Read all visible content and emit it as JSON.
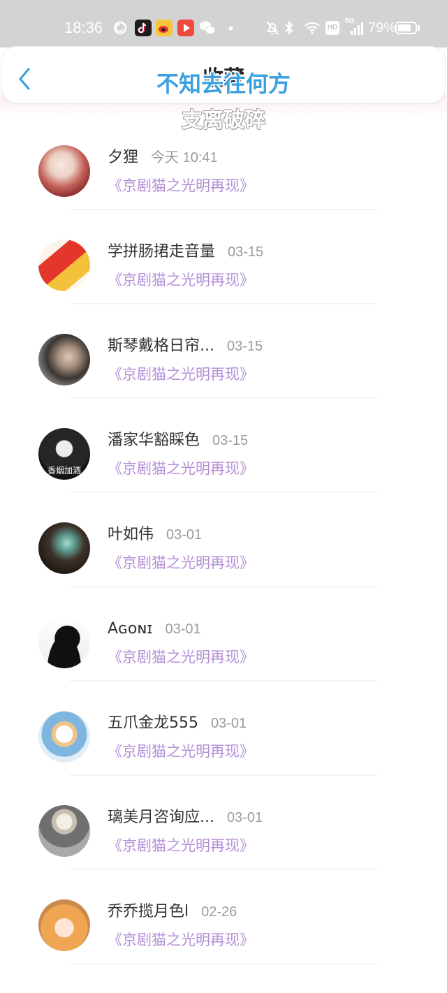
{
  "status_bar": {
    "time": "18:36",
    "notification_icons": [
      "music-app-icon",
      "douyin-icon",
      "weibo-icon",
      "video-app-icon",
      "wechat-icon"
    ],
    "system_icons": [
      "bell-off-icon",
      "bluetooth-icon",
      "wifi-icon"
    ],
    "hd_label": "HD",
    "network": "5G",
    "battery_text": "79%",
    "battery_level": 79
  },
  "header": {
    "back_icon": "chevron-left-icon",
    "title": "收藏",
    "accent_color": "#3ba1e2"
  },
  "overlay": {
    "line1": "不知去往何方",
    "line2": "支离破碎"
  },
  "list": {
    "subtitle_color": "#b48fd8",
    "items": [
      {
        "name": "夕狸",
        "time": "今天 10:41",
        "work": "《京剧猫之光明再现》"
      },
      {
        "name": "学拼肠捃走音量",
        "time": "03-15",
        "work": "《京剧猫之光明再现》"
      },
      {
        "name": "斯琴戴格日帘...",
        "time": "03-15",
        "work": "《京剧猫之光明再现》"
      },
      {
        "name": "潘家华豁睬色",
        "time": "03-15",
        "work": "《京剧猫之光明再现》",
        "avatar_text": "香烟加酒"
      },
      {
        "name": "叶如伟",
        "time": "03-01",
        "work": "《京剧猫之光明再现》"
      },
      {
        "name": "Aɢᴏɴɪ",
        "time": "03-01",
        "work": "《京剧猫之光明再现》"
      },
      {
        "name": "五爪金龙555",
        "time": "03-01",
        "work": "《京剧猫之光明再现》"
      },
      {
        "name": "璃美月咨询应...",
        "time": "03-01",
        "work": "《京剧猫之光明再现》"
      },
      {
        "name": "乔乔揽月色l",
        "time": "02-26",
        "work": "《京剧猫之光明再现》"
      }
    ]
  }
}
